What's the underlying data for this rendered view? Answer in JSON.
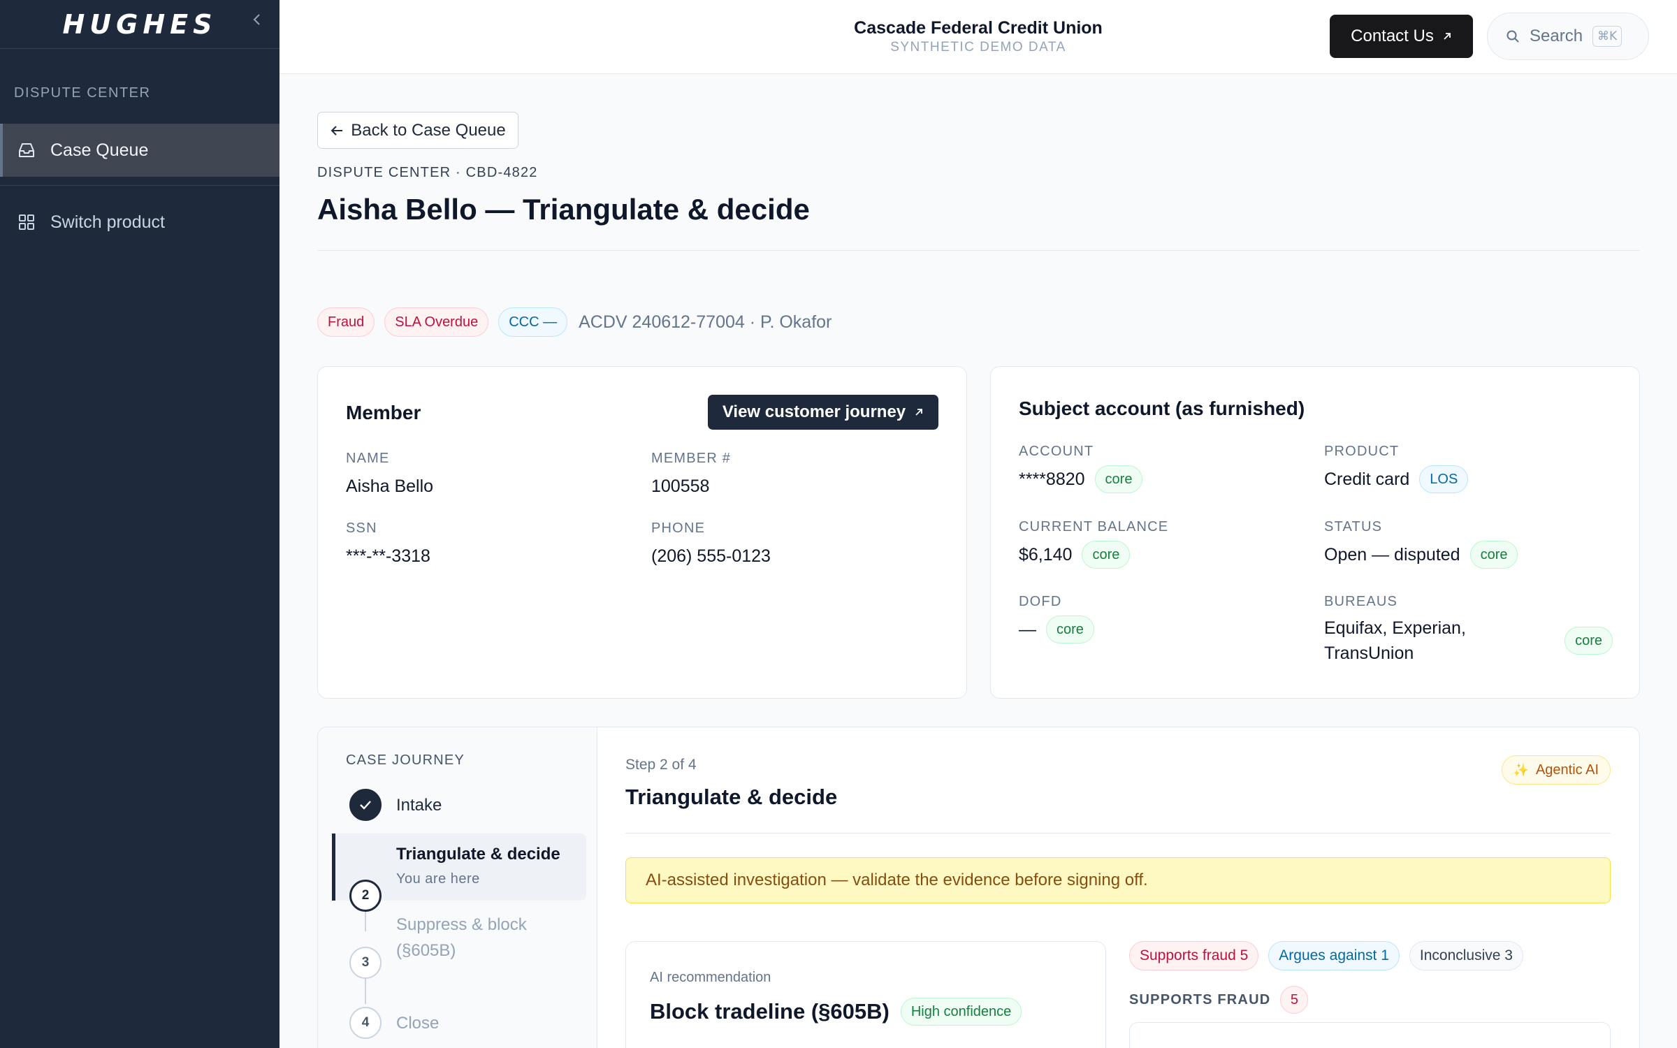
{
  "sidebar": {
    "brand": "HUGHES",
    "section_label": "DISPUTE CENTER",
    "items": [
      {
        "label": "Case Queue",
        "icon": "inbox-icon",
        "active": true
      },
      {
        "label": "Switch product",
        "icon": "grid-icon",
        "active": false
      }
    ]
  },
  "header": {
    "org_name": "Cascade Federal Credit Union",
    "org_sub": "SYNTHETIC DEMO DATA",
    "contact_label": "Contact Us",
    "search_label": "Search",
    "search_shortcut": "⌘K"
  },
  "page": {
    "back_label": "Back to Case Queue",
    "breadcrumb": "DISPUTE CENTER · CBD-4822",
    "title": "Aisha Bello — Triangulate & decide",
    "badges": [
      "Fraud",
      "SLA Overdue",
      "CCC —"
    ],
    "acdv_ref": "ACDV 240612-77004 · P. Okafor"
  },
  "member": {
    "title": "Member",
    "journey_button": "View customer journey",
    "fields": [
      {
        "label": "NAME",
        "value": "Aisha Bello"
      },
      {
        "label": "MEMBER #",
        "value": "100558"
      },
      {
        "label": "SSN",
        "value": "***-**-3318"
      },
      {
        "label": "PHONE",
        "value": "(206) 555-0123"
      }
    ]
  },
  "account": {
    "title": "Subject account (as furnished)",
    "fields": [
      {
        "label": "ACCOUNT",
        "value": "****8820",
        "tag": "core"
      },
      {
        "label": "PRODUCT",
        "value": "Credit card",
        "tag": "LOS"
      },
      {
        "label": "CURRENT BALANCE",
        "value": "$6,140",
        "tag": "core"
      },
      {
        "label": "STATUS",
        "value": "Open — disputed",
        "tag": "core"
      },
      {
        "label": "DOFD",
        "value": "—",
        "tag": "core"
      },
      {
        "label": "BUREAUS",
        "value": "Equifax, Experian, TransUnion",
        "tag": "core"
      }
    ]
  },
  "journey": {
    "label": "CASE JOURNEY",
    "steps": [
      {
        "number": "1",
        "name": "Intake",
        "status": "done"
      },
      {
        "number": "2",
        "name": "Triangulate & decide",
        "sub": "You are here",
        "status": "current"
      },
      {
        "number": "3",
        "name": "Suppress & block (§605B)",
        "status": "pending"
      },
      {
        "number": "4",
        "name": "Close",
        "status": "pending"
      }
    ]
  },
  "step_detail": {
    "meta": "Step 2 of 4",
    "title": "Triangulate & decide",
    "agentic_label": "Agentic AI",
    "banner": "AI-assisted investigation — validate the evidence before signing off.",
    "recommendation_label": "AI recommendation",
    "recommendation_title": "Block tradeline (§605B)",
    "confidence": "High confidence",
    "evidence_pills": [
      "Supports fraud 5",
      "Argues against 1",
      "Inconclusive 3"
    ],
    "supports_heading": "SUPPORTS FRAUD",
    "supports_count": "5"
  },
  "colors": {
    "sidebar_bg": "#1e293b",
    "accent_dark": "#18181b",
    "fraud_red": "#be123c",
    "info_blue": "#0369a1",
    "core_green": "#15803d",
    "banner_yellow": "#fef9c3"
  }
}
